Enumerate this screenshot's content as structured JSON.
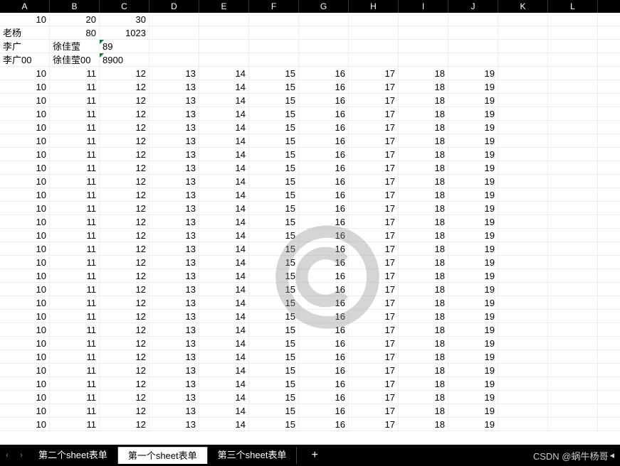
{
  "columns": [
    "A",
    "B",
    "C",
    "D",
    "E",
    "F",
    "G",
    "H",
    "I",
    "J",
    "K",
    "L"
  ],
  "rows": [
    {
      "cells": [
        {
          "v": "10",
          "t": "num"
        },
        {
          "v": "20",
          "t": "num"
        },
        {
          "v": "30",
          "t": "num"
        },
        {
          "v": "",
          "t": "num"
        },
        {
          "v": "",
          "t": "num"
        },
        {
          "v": "",
          "t": "num"
        },
        {
          "v": "",
          "t": "num"
        },
        {
          "v": "",
          "t": "num"
        },
        {
          "v": "",
          "t": "num"
        },
        {
          "v": "",
          "t": "num"
        },
        {
          "v": "",
          "t": "num"
        },
        {
          "v": "",
          "t": "num"
        }
      ]
    },
    {
      "cells": [
        {
          "v": "老杨",
          "t": "txt"
        },
        {
          "v": "80",
          "t": "num"
        },
        {
          "v": "1023",
          "t": "num"
        },
        {
          "v": "",
          "t": "num"
        },
        {
          "v": "",
          "t": "num"
        },
        {
          "v": "",
          "t": "num"
        },
        {
          "v": "",
          "t": "num"
        },
        {
          "v": "",
          "t": "num"
        },
        {
          "v": "",
          "t": "num"
        },
        {
          "v": "",
          "t": "num"
        },
        {
          "v": "",
          "t": "num"
        },
        {
          "v": "",
          "t": "num"
        }
      ]
    },
    {
      "cells": [
        {
          "v": "李广",
          "t": "txt"
        },
        {
          "v": "徐佳莹",
          "t": "txt"
        },
        {
          "v": "89",
          "t": "txt",
          "corner": true
        },
        {
          "v": "",
          "t": "num"
        },
        {
          "v": "",
          "t": "num"
        },
        {
          "v": "",
          "t": "num"
        },
        {
          "v": "",
          "t": "num"
        },
        {
          "v": "",
          "t": "num"
        },
        {
          "v": "",
          "t": "num"
        },
        {
          "v": "",
          "t": "num"
        },
        {
          "v": "",
          "t": "num"
        },
        {
          "v": "",
          "t": "num"
        }
      ]
    },
    {
      "cells": [
        {
          "v": "李广00",
          "t": "txt"
        },
        {
          "v": "徐佳莹00",
          "t": "txt"
        },
        {
          "v": "8900",
          "t": "txt",
          "corner": true
        },
        {
          "v": "",
          "t": "num"
        },
        {
          "v": "",
          "t": "num"
        },
        {
          "v": "",
          "t": "num"
        },
        {
          "v": "",
          "t": "num"
        },
        {
          "v": "",
          "t": "num"
        },
        {
          "v": "",
          "t": "num"
        },
        {
          "v": "",
          "t": "num"
        },
        {
          "v": "",
          "t": "num"
        },
        {
          "v": "",
          "t": "num"
        }
      ]
    }
  ],
  "repeat_row": {
    "cells": [
      {
        "v": "10",
        "t": "num"
      },
      {
        "v": "11",
        "t": "num"
      },
      {
        "v": "12",
        "t": "num"
      },
      {
        "v": "13",
        "t": "num"
      },
      {
        "v": "14",
        "t": "num"
      },
      {
        "v": "15",
        "t": "num"
      },
      {
        "v": "16",
        "t": "num"
      },
      {
        "v": "17",
        "t": "num"
      },
      {
        "v": "18",
        "t": "num"
      },
      {
        "v": "19",
        "t": "num"
      },
      {
        "v": "",
        "t": "num"
      },
      {
        "v": "",
        "t": "num"
      }
    ]
  },
  "repeat_count": 27,
  "tabs": [
    {
      "label": "第二个sheet表单",
      "active": false
    },
    {
      "label": "第一个sheet表单",
      "active": true
    },
    {
      "label": "第三个sheet表单",
      "active": false
    }
  ],
  "add_tab_label": "+",
  "nav": {
    "prev": "‹",
    "next": "›"
  },
  "attribution": "CSDN @蜗牛杨哥"
}
